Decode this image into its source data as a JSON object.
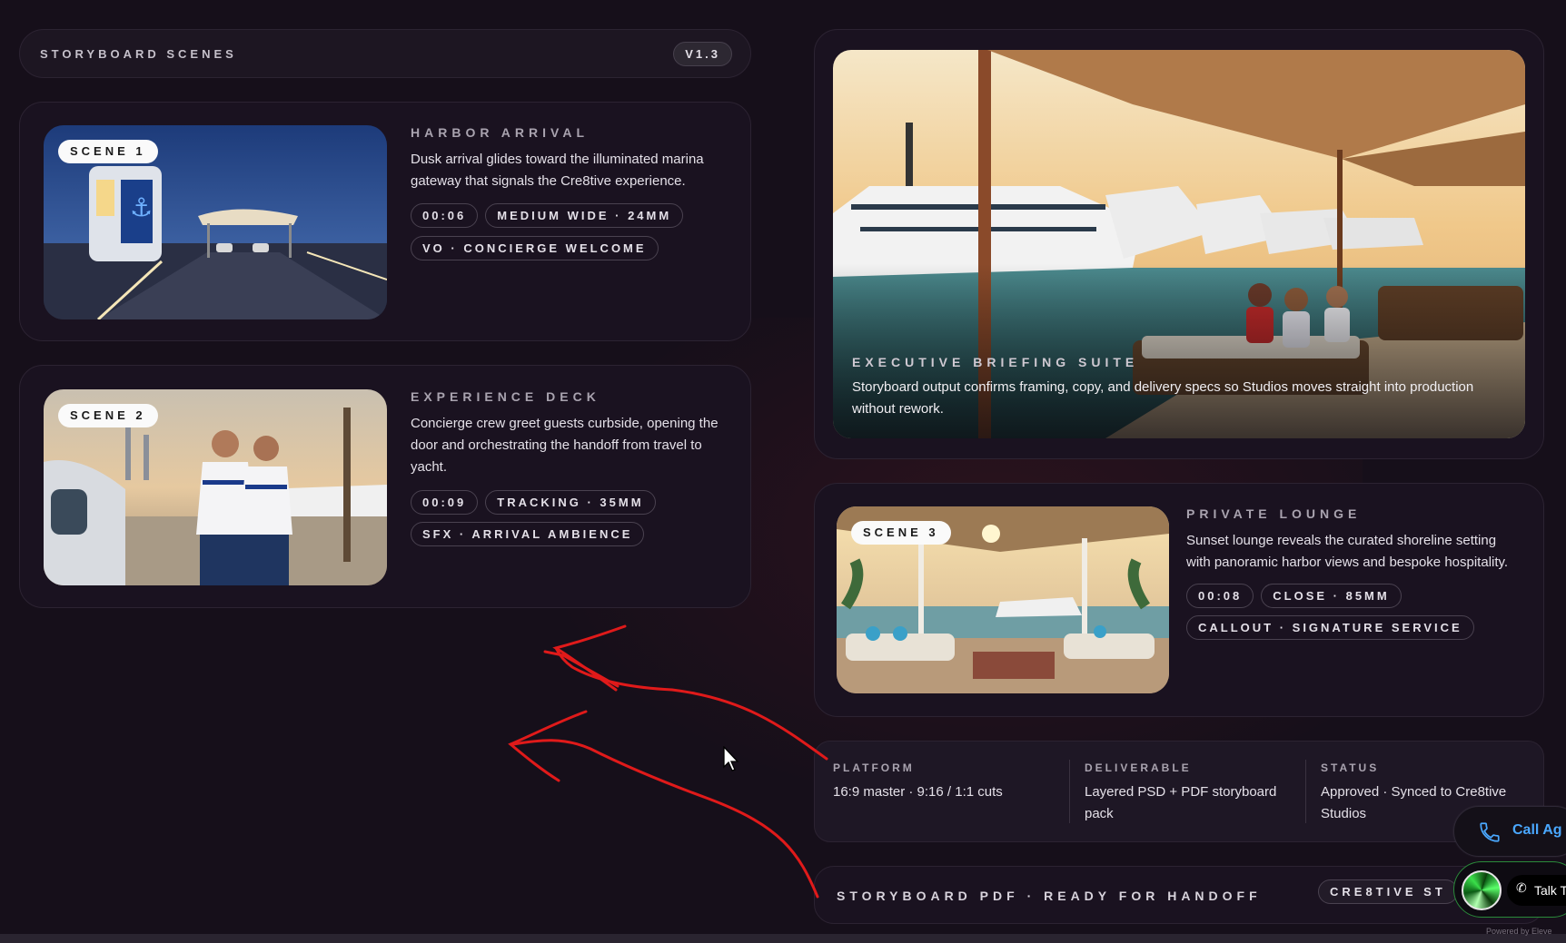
{
  "header": {
    "title": "STORYBOARD SCENES",
    "version": "V1.3"
  },
  "scenes": [
    {
      "tag": "SCENE 1",
      "title": "HARBOR ARRIVAL",
      "description": "Dusk arrival glides toward the illuminated marina gateway that signals the Cre8tive experience.",
      "duration": "00:06",
      "shot": "MEDIUM WIDE · 24MM",
      "audio": "VO · CONCIERGE WELCOME"
    },
    {
      "tag": "SCENE 2",
      "title": "EXPERIENCE DECK",
      "description": "Concierge crew greet guests curbside, opening the door and orchestrating the handoff from travel to yacht.",
      "duration": "00:09",
      "shot": "TRACKING · 35MM",
      "audio": "SFX · ARRIVAL AMBIENCE"
    },
    {
      "tag": "SCENE 3",
      "title": "PRIVATE LOUNGE",
      "description": "Sunset lounge reveals the curated shoreline setting with panoramic harbor views and bespoke hospitality.",
      "duration": "00:08",
      "shot": "CLOSE · 85MM",
      "audio": "CALLOUT · SIGNATURE SERVICE"
    }
  ],
  "hero": {
    "title": "EXECUTIVE BRIEFING SUITE",
    "description": "Storyboard output confirms framing, copy, and delivery specs so Studios moves straight into production without rework."
  },
  "specs": [
    {
      "label": "PLATFORM",
      "value": "16:9 master · 9:16 / 1:1 cuts"
    },
    {
      "label": "DELIVERABLE",
      "value": "Layered PSD + PDF storyboard pack"
    },
    {
      "label": "STATUS",
      "value": "Approved · Synced to Cre8tive Studios"
    }
  ],
  "footer": {
    "label": "STORYBOARD PDF · READY FOR HANDOFF",
    "brand": "CRE8TIVE ST"
  },
  "widget": {
    "call_label": "Call Ag",
    "talk_label": "Talk T",
    "powered": "Powered by Eleve"
  },
  "colors": {
    "background": "#160f1a",
    "accent": "#4aa8ff",
    "annotation": "#e01a1a"
  }
}
